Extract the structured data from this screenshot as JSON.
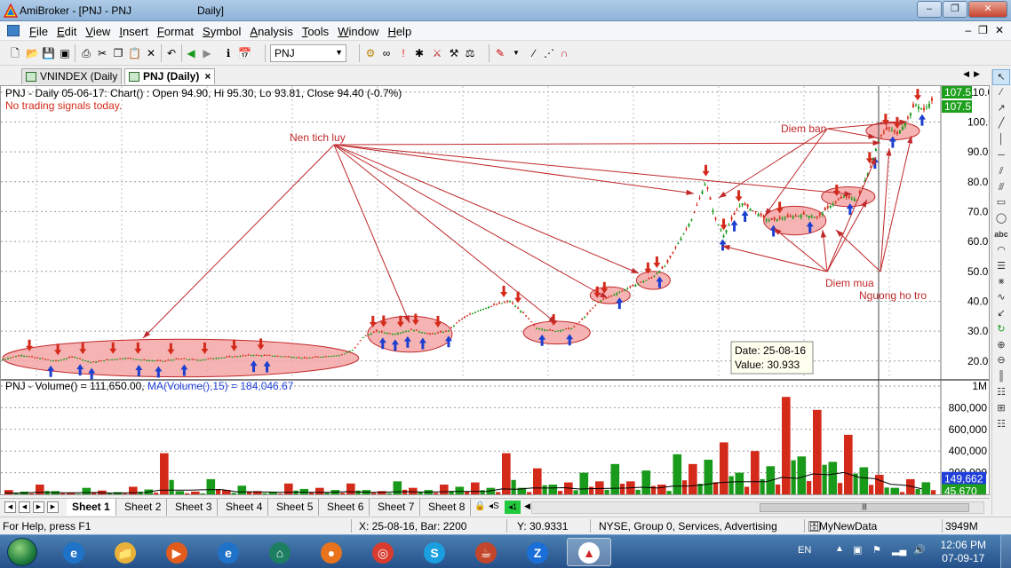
{
  "window": {
    "app_name": "AmiBroker",
    "title": "AmiBroker - [PNJ - PNJ",
    "subtitle": "Daily]"
  },
  "menu": {
    "items": [
      {
        "label": "File",
        "key": "F",
        "rest": "ile"
      },
      {
        "label": "Edit",
        "key": "E",
        "rest": "dit"
      },
      {
        "label": "View",
        "key": "V",
        "rest": "iew"
      },
      {
        "label": "Insert",
        "key": "I",
        "rest": "nsert"
      },
      {
        "label": "Format",
        "key": "F",
        "rest": "ormat"
      },
      {
        "label": "Symbol",
        "key": "S",
        "rest": "ymbol"
      },
      {
        "label": "Analysis",
        "key": "A",
        "rest": "nalysis"
      },
      {
        "label": "Tools",
        "key": "T",
        "rest": "ools"
      },
      {
        "label": "Window",
        "key": "W",
        "rest": "indow"
      },
      {
        "label": "Help",
        "key": "H",
        "rest": "elp"
      }
    ]
  },
  "toolbar": {
    "symbol": "PNJ"
  },
  "tabs": [
    {
      "label": "VNINDEX (Daily",
      "active": false
    },
    {
      "label": "PNJ (Daily)",
      "active": true,
      "close": "×"
    }
  ],
  "chart": {
    "header": "PNJ - Daily 05-06-17: Chart() : Open 94.90, Hi 95.30, Lo 93.81, Close 94.40 (-0.7%)",
    "signals": "No trading signals today.",
    "volume_header_prefix": "PNJ - Volume() = 111,650.00, ",
    "volume_header_ma": "MA(Volume(),15) = 184,046.67",
    "annotations": {
      "accumulation": "Nen tich luy",
      "sell_zone": "Diem ban",
      "buy_zone": "Diem mua",
      "support": "Nguong ho tro"
    },
    "tooltip": {
      "date": "Date: 25-08-16",
      "value": "Value: 30.933"
    },
    "price_labels": {
      "current": "107.5",
      "previous": "107.5"
    },
    "volume_labels": {
      "current": "149,662",
      "ma": "45,670"
    },
    "colors": {
      "up": "#1a9a1a",
      "down": "#d42a1a",
      "buy_arrow": "#1c3fd0",
      "sell_arrow": "#d42a1a",
      "zone": "#f4a6a6",
      "annotation": "#c0282a",
      "price_bg": "#1e9f1e",
      "volume_bg": "#1f3fd8"
    }
  },
  "chart_data": [
    {
      "type": "candlestick",
      "symbol": "PNJ",
      "interval": "Daily",
      "ylim": [
        14,
        112
      ],
      "y_ticks": [
        20.0,
        30.0,
        40.0,
        50.0,
        60.0,
        70.0,
        80.0,
        90.0,
        100.0,
        110.0
      ],
      "grid": true,
      "series": [
        {
          "name": "PNJ",
          "close_path": [
            {
              "i": 0,
              "v": 20.5
            },
            {
              "i": 20,
              "v": 22.0
            },
            {
              "i": 40,
              "v": 21.0
            },
            {
              "i": 60,
              "v": 20.0
            },
            {
              "i": 80,
              "v": 21.5
            },
            {
              "i": 100,
              "v": 19.5
            },
            {
              "i": 120,
              "v": 20.5
            },
            {
              "i": 140,
              "v": 21.0
            },
            {
              "i": 160,
              "v": 20.3
            },
            {
              "i": 180,
              "v": 20.0
            },
            {
              "i": 200,
              "v": 20.8
            },
            {
              "i": 220,
              "v": 20.3
            },
            {
              "i": 240,
              "v": 21.0
            },
            {
              "i": 260,
              "v": 21.5
            },
            {
              "i": 280,
              "v": 22.0
            },
            {
              "i": 300,
              "v": 21.8
            },
            {
              "i": 320,
              "v": 21.5
            },
            {
              "i": 340,
              "v": 21.0
            },
            {
              "i": 360,
              "v": 21.5
            },
            {
              "i": 380,
              "v": 22.0
            },
            {
              "i": 395,
              "v": 24.0
            },
            {
              "i": 405,
              "v": 28.0
            },
            {
              "i": 420,
              "v": 30.0
            },
            {
              "i": 440,
              "v": 29.0
            },
            {
              "i": 460,
              "v": 30.5
            },
            {
              "i": 480,
              "v": 29.0
            },
            {
              "i": 500,
              "v": 30.0
            },
            {
              "i": 515,
              "v": 34.0
            },
            {
              "i": 535,
              "v": 37.0
            },
            {
              "i": 555,
              "v": 39.0
            },
            {
              "i": 570,
              "v": 40.0
            },
            {
              "i": 585,
              "v": 36.0
            },
            {
              "i": 600,
              "v": 31.0
            },
            {
              "i": 620,
              "v": 30.0
            },
            {
              "i": 640,
              "v": 31.0
            },
            {
              "i": 655,
              "v": 35.0
            },
            {
              "i": 670,
              "v": 40.0
            },
            {
              "i": 685,
              "v": 42.0
            },
            {
              "i": 700,
              "v": 44.0
            },
            {
              "i": 715,
              "v": 46.0
            },
            {
              "i": 730,
              "v": 48.0
            },
            {
              "i": 745,
              "v": 52.0
            },
            {
              "i": 760,
              "v": 60.0
            },
            {
              "i": 775,
              "v": 68.0
            },
            {
              "i": 790,
              "v": 80.0
            },
            {
              "i": 800,
              "v": 68.0
            },
            {
              "i": 810,
              "v": 62.0
            },
            {
              "i": 820,
              "v": 68.0
            },
            {
              "i": 830,
              "v": 73.0
            },
            {
              "i": 845,
              "v": 70.0
            },
            {
              "i": 860,
              "v": 67.0
            },
            {
              "i": 880,
              "v": 68.0
            },
            {
              "i": 900,
              "v": 69.0
            },
            {
              "i": 915,
              "v": 68.0
            },
            {
              "i": 930,
              "v": 72.0
            },
            {
              "i": 945,
              "v": 75.0
            },
            {
              "i": 960,
              "v": 74.0
            },
            {
              "i": 975,
              "v": 85.0
            },
            {
              "i": 985,
              "v": 95.0
            },
            {
              "i": 995,
              "v": 98.0
            },
            {
              "i": 1005,
              "v": 96.0
            },
            {
              "i": 1015,
              "v": 100.0
            },
            {
              "i": 1025,
              "v": 106.0
            },
            {
              "i": 1035,
              "v": 104.0
            },
            {
              "i": 1045,
              "v": 107.5
            }
          ]
        }
      ],
      "buy_signals": [
        54,
        87,
        100,
        153,
        175,
        204,
        282,
        297,
        427,
        441,
        455,
        472,
        501,
        606,
        637,
        693,
        738,
        809,
        822,
        834,
        866,
        907,
        952,
        980,
        1000,
        1033
      ],
      "sell_signals": [
        30,
        62,
        90,
        124,
        152,
        189,
        227,
        260,
        290,
        416,
        428,
        447,
        464,
        489,
        563,
        579,
        619,
        668,
        676,
        725,
        735,
        790,
        810,
        827,
        873,
        937,
        974,
        992,
        1005,
        1028
      ],
      "zones": [
        {
          "label": "Nen tich luy",
          "from": 0,
          "to": 400
        },
        {
          "label": "Nen tich luy",
          "from": 410,
          "to": 505
        },
        {
          "label": "Nen tich luy",
          "from": 585,
          "to": 660
        },
        {
          "label": "Nen tich luy",
          "from": 660,
          "to": 705
        },
        {
          "label": "Nen tich luy",
          "from": 712,
          "to": 750
        },
        {
          "label": "Diem ban",
          "from": 855,
          "to": 925
        },
        {
          "label": "Diem ban",
          "from": 920,
          "to": 980
        },
        {
          "label": "Diem ban",
          "from": 970,
          "to": 1030
        }
      ],
      "annotations": [
        "Nen tich luy",
        "Diem ban",
        "Diem mua",
        "Nguong ho tro"
      ],
      "cursor": {
        "date": "25-08-16",
        "value": 30.933,
        "bar": 2200
      },
      "last_label": 107.5
    },
    {
      "type": "bar",
      "title": "PNJ - Volume()",
      "ylim": [
        0,
        1000000
      ],
      "y_ticks": [
        "200,000",
        "400,000",
        "600,000",
        "800,000",
        "1M"
      ],
      "moving_average": {
        "name": "MA(Volume(),15)",
        "last": 184046.67
      },
      "last_volume": 111650.0,
      "ma_label": 45670,
      "volume_label": 149662,
      "values": [
        40000,
        25000,
        90000,
        30000,
        15000,
        60000,
        35000,
        20000,
        70000,
        45000,
        380000,
        30000,
        25000,
        140000,
        40000,
        80000,
        30000,
        20000,
        100000,
        50000,
        60000,
        40000,
        100000,
        40000,
        30000,
        120000,
        60000,
        40000,
        90000,
        70000,
        110000,
        60000,
        380000,
        60000,
        240000,
        90000,
        110000,
        200000,
        120000,
        280000,
        120000,
        220000,
        90000,
        370000,
        280000,
        320000,
        480000,
        200000,
        400000,
        260000,
        900000,
        350000,
        780000,
        300000,
        550000,
        250000,
        180000,
        60000,
        140000,
        111650
      ]
    }
  ],
  "sheets": [
    "Sheet 1",
    "Sheet 2",
    "Sheet 3",
    "Sheet 4",
    "Sheet 5",
    "Sheet 6",
    "Sheet 7",
    "Sheet 8"
  ],
  "sheet_active": "Sheet 1",
  "status": {
    "help": "For Help, press F1",
    "x": "X: 25-08-16, Bar: 2200",
    "y": "Y: 30.9331",
    "exchange": "NYSE, Group 0, Services, Advertising",
    "database": "MyNewData",
    "memory": "3949M"
  },
  "taskbar": {
    "lang": "EN",
    "time": "12:06 PM",
    "date": "07-09-17",
    "apps": [
      "Internet Explorer",
      "File Explorer",
      "Media Player",
      "Internet Explorer",
      "AmiBroker Home",
      "Firefox",
      "Chrome",
      "Skype",
      "Java",
      "Zalo",
      "AmiBroker"
    ]
  }
}
